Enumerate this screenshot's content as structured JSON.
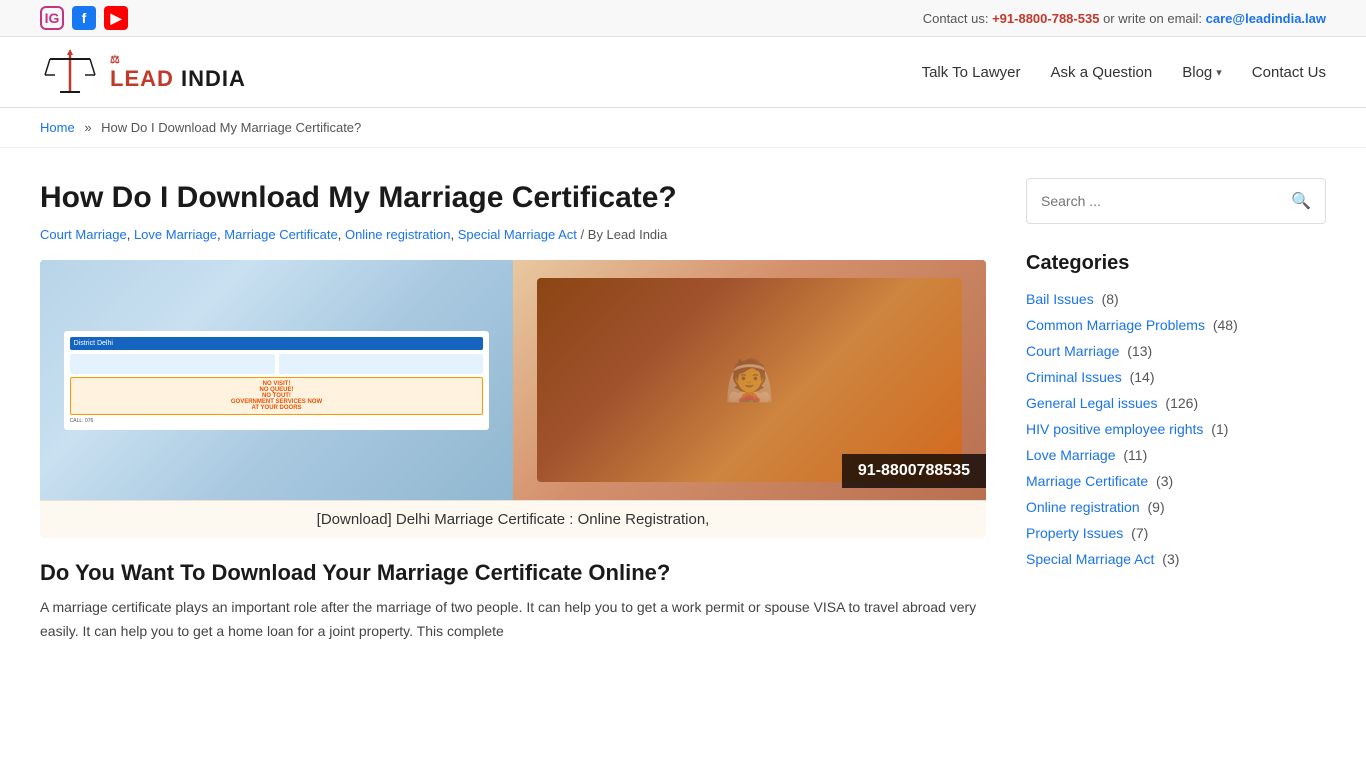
{
  "topbar": {
    "contact_text": "Contact us: ",
    "phone": "+91-8800-788-535",
    "email_text": " or write on email: ",
    "email": "care@leadindia.law"
  },
  "nav": {
    "talk_to_lawyer": "Talk To Lawyer",
    "ask_question": "Ask a Question",
    "blog": "Blog",
    "contact_us": "Contact Us"
  },
  "breadcrumb": {
    "home": "Home",
    "separator": "»",
    "current": "How Do I Download My Marriage Certificate?"
  },
  "article": {
    "title": "How Do I Download My Marriage Certificate?",
    "meta_tags": "Court Marriage, Love Marriage, Marriage Certificate, Online registration, Special Marriage Act",
    "meta_by": "/ By Lead India",
    "image_caption": "[Download] Delhi Marriage Certificate : Online Registration,",
    "phone_overlay": "91-8800788535",
    "subheading": "Do You Want To Download Your Marriage Certificate Online?",
    "body1": "A marriage certificate plays an important role after the marriage of two people. It can help you to get a work permit or spouse VISA to travel abroad very easily. It can help you to get a home loan for a joint property. This complete"
  },
  "sidebar": {
    "search_placeholder": "Search ...",
    "search_label": "Search",
    "categories_title": "Categories",
    "categories": [
      {
        "name": "Bail Issues",
        "count": "(8)",
        "href": "#"
      },
      {
        "name": "Common Marriage Problems",
        "count": "(48)",
        "href": "#"
      },
      {
        "name": "Court Marriage",
        "count": "(13)",
        "href": "#"
      },
      {
        "name": "Criminal Issues",
        "count": "(14)",
        "href": "#"
      },
      {
        "name": "General Legal issues",
        "count": "(126)",
        "href": "#"
      },
      {
        "name": "HIV positive employee rights",
        "count": "(1)",
        "href": "#"
      },
      {
        "name": "Love Marriage",
        "count": "(11)",
        "href": "#"
      },
      {
        "name": "Marriage Certificate",
        "count": "(3)",
        "href": "#"
      },
      {
        "name": "Online registration",
        "count": "(9)",
        "href": "#"
      },
      {
        "name": "Property Issues",
        "count": "(7)",
        "href": "#"
      },
      {
        "name": "Special Marriage Act",
        "count": "(3)",
        "href": "#"
      }
    ]
  },
  "logo": {
    "brand": "LEAD INDIA"
  },
  "social": {
    "instagram": "IG",
    "facebook": "f",
    "youtube": "▶"
  }
}
